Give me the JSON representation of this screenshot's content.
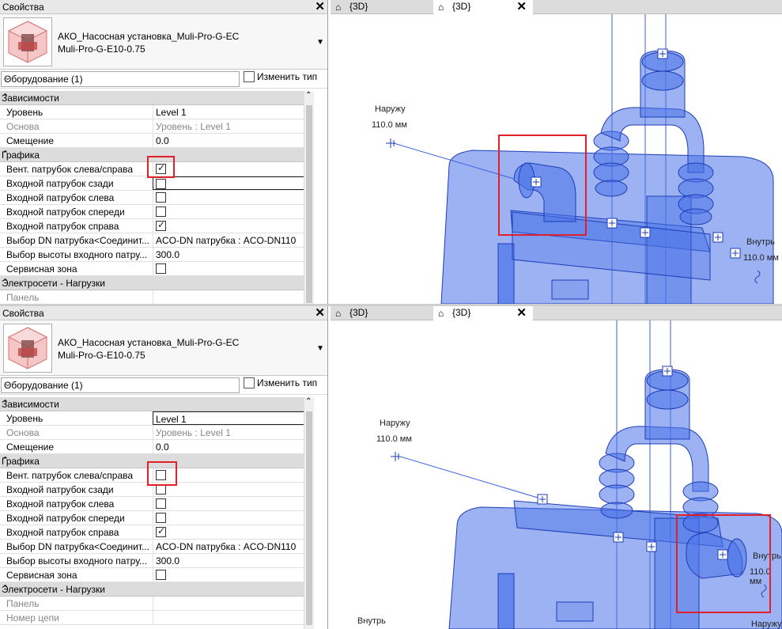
{
  "panels": [
    {
      "title": "Свойства",
      "family": "АКО_Насосная установка_Muli-Pro-G-EC",
      "type": "Muli-Pro-G-E10-0.75",
      "filter": "Оборудование (1)",
      "edit_type": "Изменить тип",
      "sections": {
        "constraints": "Зависимости",
        "graphics": "Графика",
        "electrical": "Электросети - Нагрузки"
      },
      "rows": {
        "level": {
          "label": "Уровень",
          "value": "Level 1"
        },
        "base": {
          "label": "Основа",
          "value": "Уровень : Level 1"
        },
        "offset": {
          "label": "Смещение",
          "value": "0.0"
        },
        "vent": {
          "label": "Вент. патрубок слева/справа",
          "checked": true
        },
        "inlet_back": {
          "label": "Входной патрубок сзади",
          "checked": false
        },
        "inlet_left": {
          "label": "Входной патрубок слева",
          "checked": false
        },
        "inlet_front": {
          "label": "Входной патрубок спереди",
          "checked": false
        },
        "inlet_right": {
          "label": "Входной патрубок справа",
          "checked": true
        },
        "dn": {
          "label": "Выбор DN патрубка<Соединит...",
          "value": "ACO-DN патрубка : ACO-DN110"
        },
        "height": {
          "label": "Выбор высоты входного патру...",
          "value": "300.0"
        },
        "service": {
          "label": "Сервисная зона",
          "checked": false
        },
        "panel": {
          "label": "Панель",
          "value": ""
        }
      },
      "view_tabs": [
        "{3D}",
        "{3D}"
      ],
      "annotations": {
        "out_label": "Наружу",
        "out_dim": "110.0 мм",
        "in_label": "Внутрь",
        "in_dim": "110.0 мм"
      }
    },
    {
      "title": "Свойства",
      "family": "АКО_Насосная установка_Muli-Pro-G-EC",
      "type": "Muli-Pro-G-E10-0.75",
      "filter": "Оборудование (1)",
      "edit_type": "Изменить тип",
      "sections": {
        "constraints": "Зависимости",
        "graphics": "Графика",
        "electrical": "Электросети - Нагрузки"
      },
      "rows": {
        "level": {
          "label": "Уровень",
          "value": "Level 1"
        },
        "base": {
          "label": "Основа",
          "value": "Уровень : Level 1"
        },
        "offset": {
          "label": "Смещение",
          "value": "0.0"
        },
        "vent": {
          "label": "Вент. патрубок слева/справа",
          "checked": false
        },
        "inlet_back": {
          "label": "Входной патрубок сзади",
          "checked": false
        },
        "inlet_left": {
          "label": "Входной патрубок слева",
          "checked": false
        },
        "inlet_front": {
          "label": "Входной патрубок спереди",
          "checked": false
        },
        "inlet_right": {
          "label": "Входной патрубок справа",
          "checked": true
        },
        "dn": {
          "label": "Выбор DN патрубка<Соединит...",
          "value": "ACO-DN патрубка : ACO-DN110"
        },
        "height": {
          "label": "Выбор высоты входного патру...",
          "value": "300.0"
        },
        "service": {
          "label": "Сервисная зона",
          "checked": false
        },
        "panel": {
          "label": "Панель",
          "value": ""
        },
        "circuit": {
          "label": "Номер цепи",
          "value": ""
        }
      },
      "view_tabs": [
        "{3D}",
        "{3D}"
      ],
      "annotations": {
        "out_label": "Наружу",
        "out_dim": "110.0 мм",
        "in_label": "Внутрь",
        "in_dim": "110.0 мм",
        "in_label2": "Внутрь",
        "out_label2": "Наружу"
      }
    }
  ],
  "colors": {
    "model_fill": "#4a73e8",
    "model_edge": "#1d3db8",
    "highlight": "#e0202a",
    "section_bg": "#dcdcdc"
  },
  "icons": [
    "close-icon",
    "collapse-icon",
    "dropdown-icon",
    "edit-type-icon",
    "3d-view-icon",
    "checkbox"
  ]
}
